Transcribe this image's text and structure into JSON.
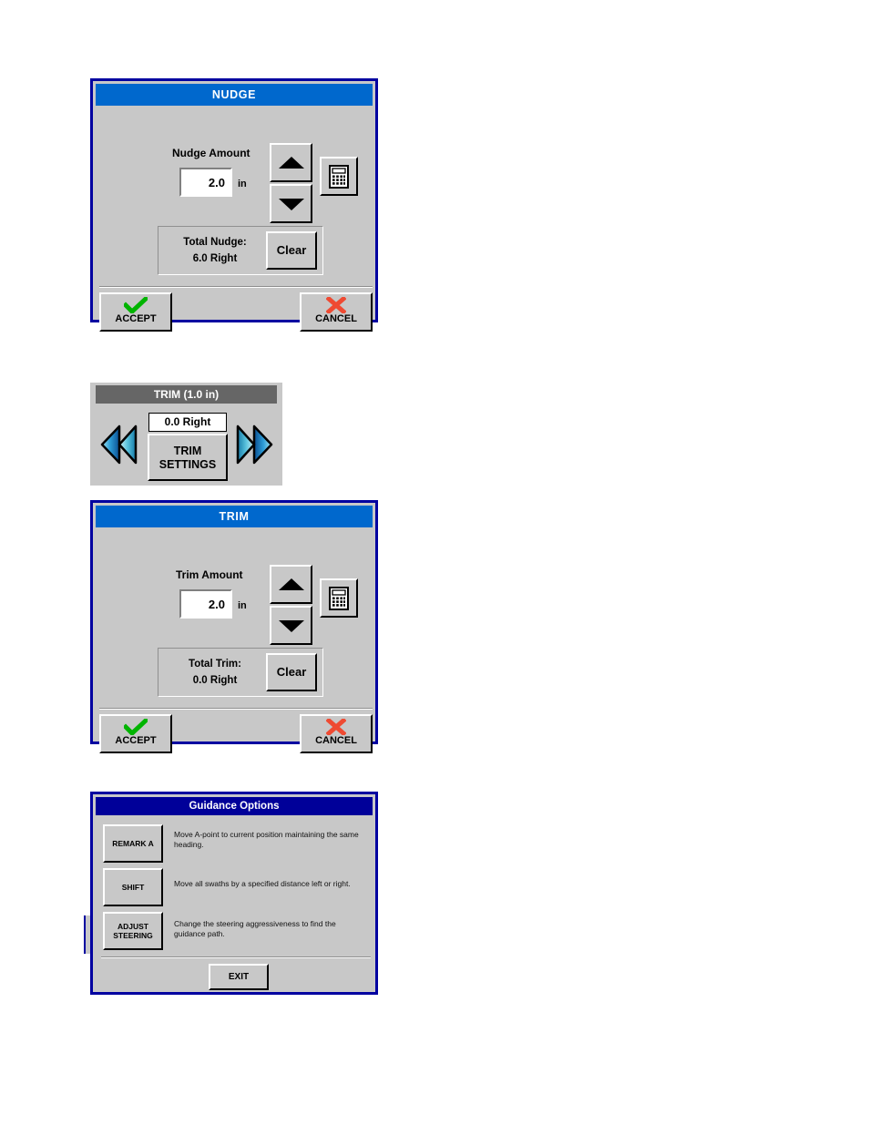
{
  "nudge_dialog": {
    "title": "NUDGE",
    "amount_label": "Nudge Amount",
    "amount_value": "2.0",
    "unit": "in",
    "increase_icon": "triangle-up-icon",
    "decrease_icon": "triangle-down-icon",
    "keypad_icon": "calculator-icon",
    "total_label": "Total Nudge:",
    "total_value": "6.0 Right",
    "clear_label": "Clear",
    "accept_label": "ACCEPT",
    "cancel_label": "CANCEL",
    "accept_icon": "green-check-icon",
    "cancel_icon": "red-x-icon",
    "title_color": "#0068cd",
    "frame_color": "#0000a0"
  },
  "trim_widget": {
    "title": "TRIM (1.0 in)",
    "readout": "0.0 Right",
    "settings_label_line1": "TRIM",
    "settings_label_line2": "SETTINGS",
    "left_icon": "double-arrow-left-icon",
    "right_icon": "double-arrow-right-icon",
    "title_color": "#666666"
  },
  "trim_dialog": {
    "title": "TRIM",
    "amount_label": "Trim Amount",
    "amount_value": "2.0",
    "unit": "in",
    "increase_icon": "triangle-up-icon",
    "decrease_icon": "triangle-down-icon",
    "keypad_icon": "calculator-icon",
    "total_label": "Total Trim:",
    "total_value": "0.0 Right",
    "clear_label": "Clear",
    "accept_label": "ACCEPT",
    "cancel_label": "CANCEL",
    "accept_icon": "green-check-icon",
    "cancel_icon": "red-x-icon",
    "title_color": "#0068cd",
    "frame_color": "#0000a0"
  },
  "guidance_dialog": {
    "title": "Guidance Options",
    "title_color": "#000099",
    "options": [
      {
        "label": "REMARK A",
        "label_line1": "REMARK A",
        "label_line2": "",
        "description": "Move A-point to current position maintaining the same heading."
      },
      {
        "label": "SHIFT",
        "label_line1": "SHIFT",
        "label_line2": "",
        "description": "Move all swaths by a specified distance left or right."
      },
      {
        "label": "ADJUST STEERING",
        "label_line1": "ADJUST",
        "label_line2": "STEERING",
        "description": "Change the steering aggressiveness to find the guidance path."
      }
    ],
    "exit_label": "EXIT"
  }
}
